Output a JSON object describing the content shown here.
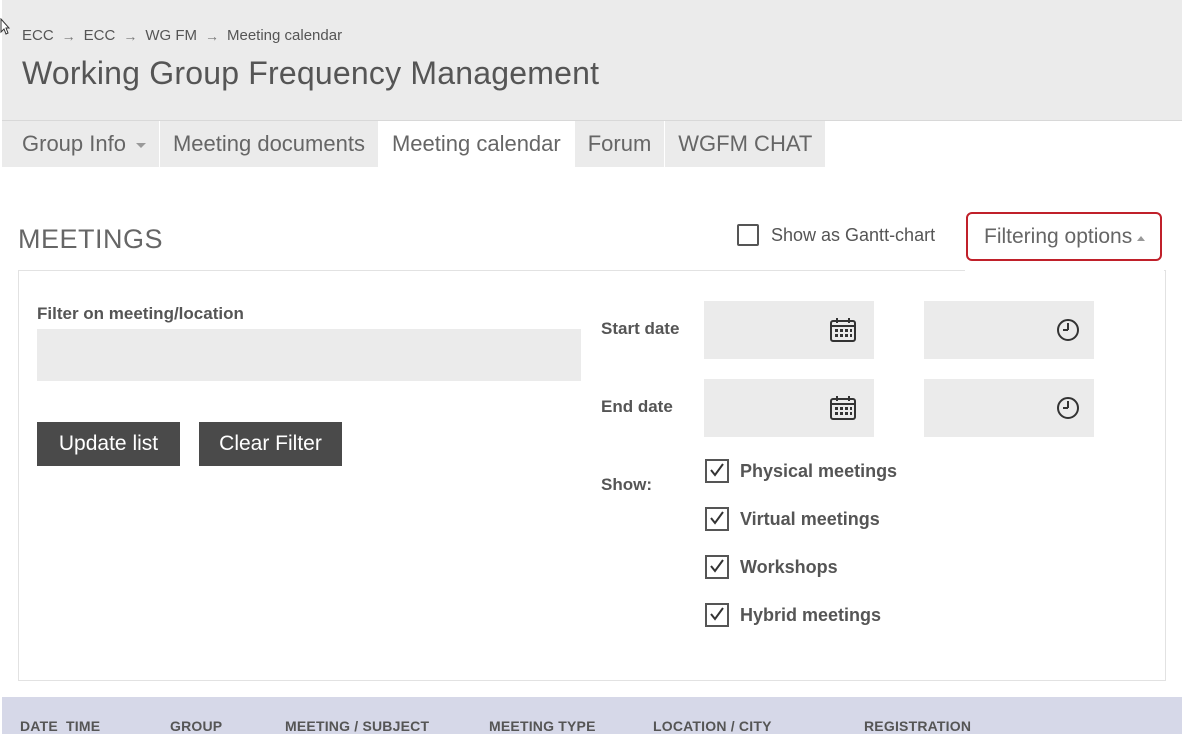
{
  "breadcrumb": {
    "items": [
      "ECC",
      "ECC",
      "WG FM",
      "Meeting calendar"
    ],
    "separator": "→"
  },
  "page_title": "Working Group Frequency Management",
  "tabs": [
    {
      "label": "Group Info",
      "has_dropdown": true,
      "active": false
    },
    {
      "label": "Meeting documents",
      "active": false
    },
    {
      "label": "Meeting calendar",
      "active": true
    },
    {
      "label": "Forum",
      "active": false
    },
    {
      "label": "WGFM CHAT",
      "active": false
    }
  ],
  "meetings": {
    "title": "MEETINGS",
    "gantt_label": "Show as Gantt-chart",
    "gantt_checked": false,
    "filter_button": "Filtering options"
  },
  "filter": {
    "meeting_label": "Filter on meeting/location",
    "meeting_value": "",
    "update_label": "Update list",
    "clear_label": "Clear Filter",
    "start_label": "Start date",
    "end_label": "End date",
    "show_label": "Show:",
    "options": [
      {
        "label": "Physical meetings",
        "checked": true
      },
      {
        "label": "Virtual meetings",
        "checked": true
      },
      {
        "label": "Workshops",
        "checked": true
      },
      {
        "label": "Hybrid meetings",
        "checked": true
      }
    ],
    "icons": {
      "date": "calendar-icon",
      "time": "clock-icon"
    }
  },
  "table": {
    "headers": [
      "DATE",
      "TIME",
      "GROUP",
      "MEETING / SUBJECT",
      "MEETING TYPE",
      "LOCATION / CITY",
      "REGISTRATION"
    ]
  },
  "colors": {
    "header_bg": "#ebebeb",
    "accent_border": "#c0202a",
    "button_bg": "#4a4a4a",
    "table_header_bg": "#d6d8e8"
  }
}
